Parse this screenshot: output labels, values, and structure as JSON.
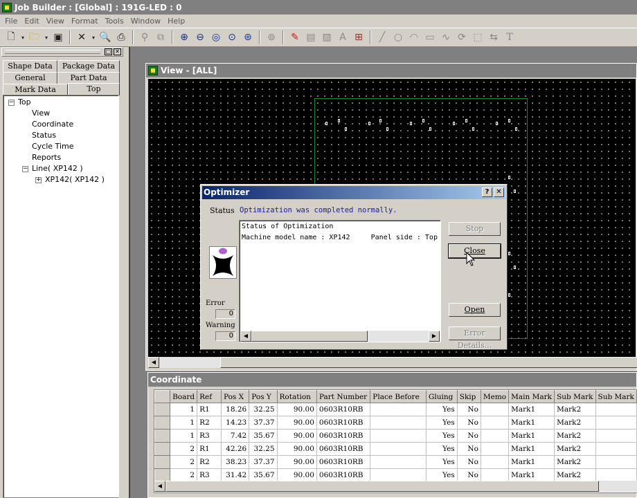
{
  "app": {
    "title": "Job Builder : [Global] : 191G-LED : 0"
  },
  "menu": [
    "File",
    "Edit",
    "View",
    "Format",
    "Tools",
    "Window",
    "Help"
  ],
  "toolbar": {
    "icons": [
      "new-icon",
      "open-folder-icon",
      "save-icon",
      "delete-icon",
      "print-preview-icon",
      "print-icon",
      "find-icon",
      "copy-icon",
      "zoom-in-icon",
      "zoom-out-icon",
      "zoom-fit-icon",
      "zoom-area-icon",
      "zoom-all-icon",
      "zoom-select-icon",
      "paint-icon",
      "grid-icon",
      "image-icon",
      "text-format-icon",
      "table-icon",
      "line-tool-icon",
      "circle-tool-icon",
      "arc-tool-icon",
      "rectangle-tool-icon",
      "curve-tool-icon",
      "rotate-tool-icon",
      "shape-tool-icon",
      "flip-tool-icon",
      "text-tool-icon"
    ]
  },
  "left_panel": {
    "tabs": {
      "shape_data": "Shape Data",
      "package_data": "Package Data",
      "general": "General",
      "part_data": "Part Data",
      "mark_data": "Mark Data",
      "top": "Top"
    },
    "tree": {
      "root": "Top",
      "children": [
        "View",
        "Coordinate",
        "Status",
        "Cycle Time",
        "Reports"
      ],
      "line": "Line( XP142 )",
      "machine": "XP142( XP142 )"
    }
  },
  "view_window": {
    "title": "View - [ALL]"
  },
  "coordinate_window": {
    "title": "Coordinate",
    "columns": [
      "Board",
      "Ref",
      "Pos X",
      "Pos Y",
      "Rotation",
      "Part Number",
      "Place Before",
      "Gluing",
      "Skip",
      "Memo",
      "Main Mark",
      "Sub Mark",
      "Sub Mark"
    ],
    "rows": [
      [
        "1",
        "R1",
        "18.26",
        "32.25",
        "90.00",
        "0603R10RB",
        "",
        "Yes",
        "No",
        "",
        "Mark1",
        "Mark2",
        ""
      ],
      [
        "1",
        "R2",
        "14.23",
        "37.37",
        "90.00",
        "0603R10RB",
        "",
        "Yes",
        "No",
        "",
        "Mark1",
        "Mark2",
        ""
      ],
      [
        "1",
        "R3",
        "7.42",
        "35.67",
        "90.00",
        "0603R10RB",
        "",
        "Yes",
        "No",
        "",
        "Mark1",
        "Mark2",
        ""
      ],
      [
        "2",
        "R1",
        "42.26",
        "32.25",
        "90.00",
        "0603R10RB",
        "",
        "Yes",
        "No",
        "",
        "Mark1",
        "Mark2",
        ""
      ],
      [
        "2",
        "R2",
        "38.23",
        "37.37",
        "90.00",
        "0603R10RB",
        "",
        "Yes",
        "No",
        "",
        "Mark1",
        "Mark2",
        ""
      ],
      [
        "2",
        "R3",
        "31.42",
        "35.67",
        "90.00",
        "0603R10RB",
        "",
        "Yes",
        "No",
        "",
        "Mark1",
        "Mark2",
        ""
      ]
    ]
  },
  "optimizer": {
    "title": "Optimizer",
    "help": "?",
    "close_x": "✕",
    "status_label": "Status",
    "status_text": "Optimization was completed normally.",
    "log": [
      "Status of Optimization",
      "Machine model name : XP142     Panel side : Top"
    ],
    "error_label": "Error",
    "error_count": "0",
    "warning_label": "Warning",
    "warning_count": "0",
    "buttons": {
      "stop": "Stop",
      "close": "Close",
      "open": "Open",
      "error_details": "Error Details..."
    }
  }
}
